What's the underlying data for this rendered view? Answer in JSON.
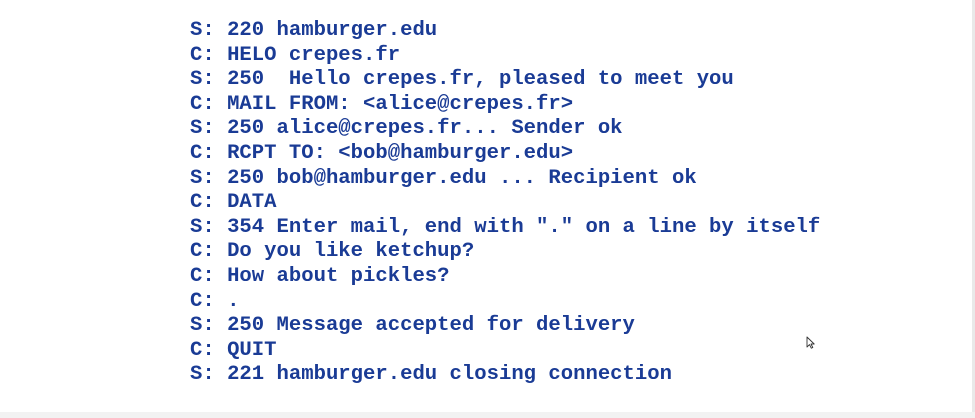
{
  "transcript": {
    "lines": [
      "S: 220 hamburger.edu",
      "C: HELO crepes.fr",
      "S: 250  Hello crepes.fr, pleased to meet you",
      "C: MAIL FROM: <alice@crepes.fr>",
      "S: 250 alice@crepes.fr... Sender ok",
      "C: RCPT TO: <bob@hamburger.edu>",
      "S: 250 bob@hamburger.edu ... Recipient ok",
      "C: DATA",
      "S: 354 Enter mail, end with \".\" on a line by itself",
      "C: Do you like ketchup?",
      "C: How about pickles?",
      "C: .",
      "S: 250 Message accepted for delivery",
      "C: QUIT",
      "S: 221 hamburger.edu closing connection"
    ]
  },
  "colors": {
    "text": "#1a3b95",
    "background": "#ffffff"
  },
  "icons": {
    "pointer": "mouse-pointer-icon"
  }
}
